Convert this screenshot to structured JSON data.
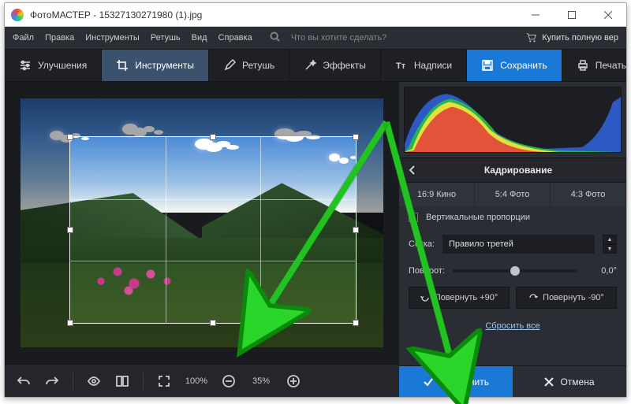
{
  "window": {
    "title": "ФотоМАСТЕР - 15327130271980 (1).jpg"
  },
  "menubar": {
    "file": "Файл",
    "edit": "Правка",
    "tools": "Инструменты",
    "retouch": "Ретушь",
    "view": "Вид",
    "help": "Справка",
    "search_placeholder": "Что вы хотите сделать?",
    "buy_full": "Купить полную вер"
  },
  "toolbar": {
    "improvements": "Улучшения",
    "tools": "Инструменты",
    "retouch": "Ретушь",
    "effects": "Эффекты",
    "captions": "Надписи",
    "save": "Сохранить",
    "print": "Печать"
  },
  "bottombar": {
    "zoom_fit": "100%",
    "zoom_current": "35%"
  },
  "panel": {
    "title": "Кадрирование",
    "aspect_169": "16:9 Кино",
    "aspect_54": "5:4 Фото",
    "aspect_43": "4:3 Фото",
    "vertical_prop": "Вертикальные пропорции",
    "grid_label": "Сетка:",
    "grid_value": "Правило третей",
    "rotation_label": "Поворот:",
    "rotation_value": "0,0°",
    "rotate_plus90": "Повернуть +90°",
    "rotate_minus90": "Повернуть -90°",
    "reset": "Сбросить все",
    "apply": "Применить",
    "cancel": "Отмена"
  }
}
